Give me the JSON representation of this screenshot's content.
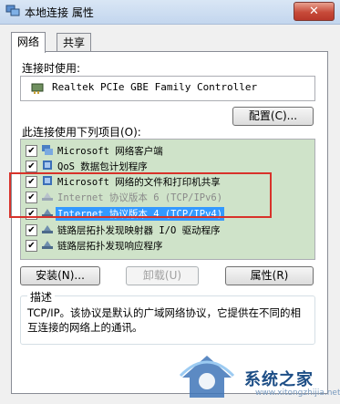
{
  "window": {
    "title": "本地连接 属性",
    "close_label": "✕"
  },
  "tabs": [
    {
      "label": "网络"
    },
    {
      "label": "共享"
    }
  ],
  "connect_using": {
    "label": "连接时使用:",
    "adapter": "Realtek PCIe GBE Family Controller",
    "configure_button": "配置(C)..."
  },
  "items_section": {
    "label": "此连接使用下列项目(O):",
    "items": [
      {
        "label": "Microsoft 网络客户端",
        "checked": true
      },
      {
        "label": "QoS 数据包计划程序",
        "checked": true
      },
      {
        "label": "Microsoft 网络的文件和打印机共享",
        "checked": true
      },
      {
        "label": "Internet 协议版本 6 (TCP/IPv6)",
        "checked": true
      },
      {
        "label": "Internet 协议版本 4 (TCP/IPv4)",
        "checked": true
      },
      {
        "label": "链路层拓扑发现映射器 I/O 驱动程序",
        "checked": true
      },
      {
        "label": "链路层拓扑发现响应程序",
        "checked": true
      }
    ]
  },
  "buttons": {
    "install": "安装(N)...",
    "uninstall": "卸载(U)",
    "properties": "属性(R)"
  },
  "description": {
    "title": "描述",
    "text": "TCP/IP。该协议是默认的广域网络协议，它提供在不同的相互连接的网络上的通讯。"
  },
  "watermark": {
    "text": "系统之家",
    "url": "www.xitongzhijia.net"
  },
  "colors": {
    "highlight_border": "#d8322a",
    "list_background": "#cfe3c9",
    "selection": "#3399ff"
  }
}
